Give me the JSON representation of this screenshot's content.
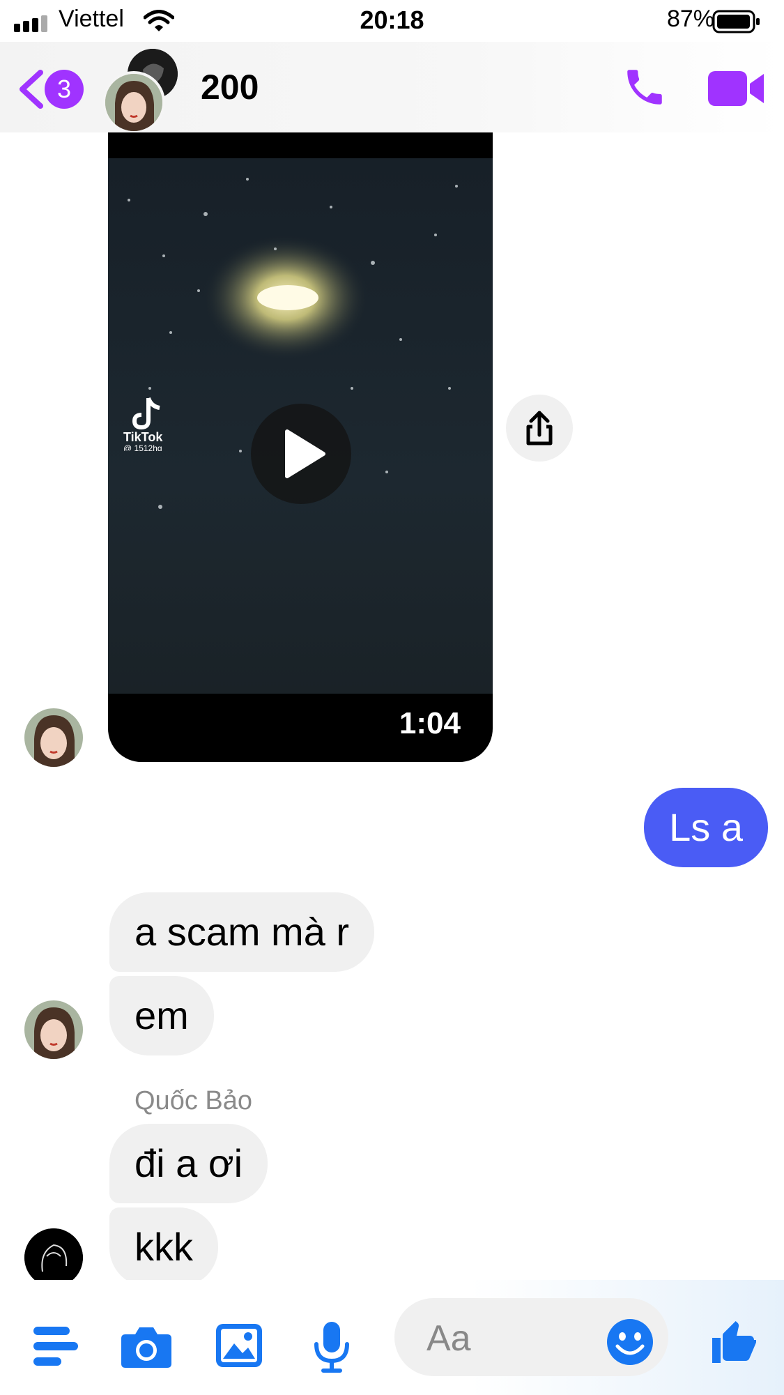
{
  "status_bar": {
    "carrier": "Viettel",
    "time": "20:18",
    "battery": "87%"
  },
  "header": {
    "back_badge": "3",
    "title": "200"
  },
  "video_message": {
    "duration": "1:04",
    "watermark_brand": "TikTok",
    "watermark_handle": "@ 1512hg"
  },
  "messages": [
    {
      "side": "out",
      "text": "Ls a"
    },
    {
      "side": "in",
      "text": "a scam mà r"
    },
    {
      "side": "in",
      "text": "em"
    },
    {
      "side": "in",
      "text": "đi a ơi"
    },
    {
      "side": "in",
      "text": "kkk"
    }
  ],
  "sender_name": "Quốc Bảo",
  "composer": {
    "placeholder": "Aa"
  },
  "colors": {
    "accent_purple": "#a033ff",
    "accent_blue": "#1877f2",
    "bubble_out": "#4a5cf5"
  }
}
